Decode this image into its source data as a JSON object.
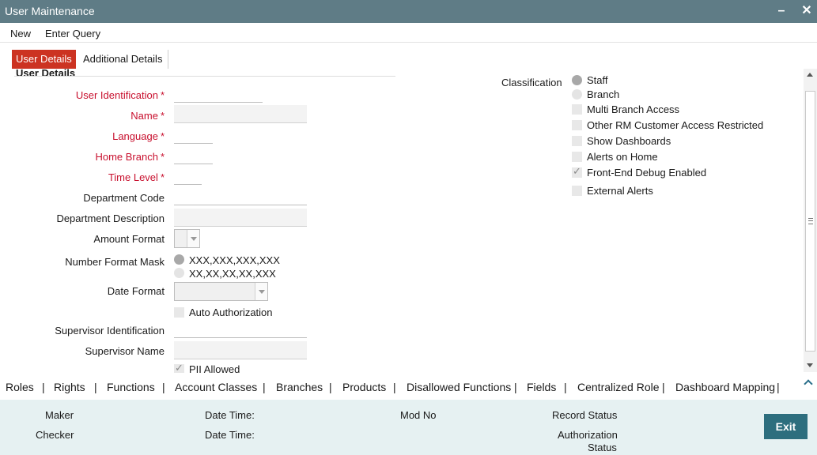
{
  "window": {
    "title": "User Maintenance",
    "minimize_symbol": "–",
    "close_symbol": "✕"
  },
  "menu": {
    "new": "New",
    "enter_query": "Enter Query"
  },
  "tabs": {
    "user_details": "User Details",
    "additional_details": "Additional Details"
  },
  "section": {
    "title": "User Details"
  },
  "fields": {
    "user_identification": "User Identification",
    "name": "Name",
    "language": "Language",
    "home_branch": "Home Branch",
    "time_level": "Time Level",
    "department_code": "Department Code",
    "department_description": "Department Description",
    "amount_format": "Amount Format",
    "number_format_mask": "Number Format Mask",
    "date_format": "Date Format",
    "auto_authorization": "Auto Authorization",
    "supervisor_identification": "Supervisor Identification",
    "supervisor_name": "Supervisor Name",
    "pii_allowed": "PII Allowed",
    "required_marker": "*"
  },
  "number_format_options": [
    "XXX,XXX,XXX,XXX",
    "XX,XX,XX,XX,XXX"
  ],
  "classification": {
    "label": "Classification",
    "staff": "Staff",
    "branch": "Branch",
    "multi_branch_access": "Multi Branch Access",
    "other_rm_restricted": "Other RM Customer Access Restricted",
    "show_dashboards": "Show Dashboards",
    "alerts_on_home": "Alerts on Home",
    "front_end_debug": "Front-End Debug Enabled",
    "external_alerts": "External Alerts"
  },
  "subscreens": {
    "items": [
      "Roles",
      "Rights",
      "Functions",
      "Account Classes",
      "Branches",
      "Products",
      "Disallowed Functions",
      "Fields",
      "Centralized Role",
      "Dashboard Mapping"
    ],
    "separator": "|"
  },
  "footer": {
    "maker": "Maker",
    "checker": "Checker",
    "date_time": "Date Time:",
    "mod_no": "Mod No",
    "record_status": "Record Status",
    "authorization": "Authorization",
    "status": "Status",
    "exit": "Exit"
  },
  "colors": {
    "title_bar": "#5f7c86",
    "active_tab": "#cc3322",
    "required_label": "#c8102e",
    "footer_bg": "#e6f1f2",
    "exit_button": "#2d6e7e"
  }
}
